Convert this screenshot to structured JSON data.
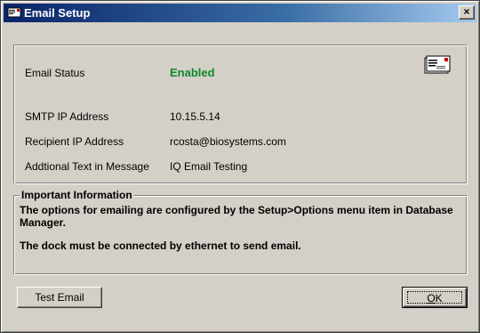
{
  "window": {
    "title": "Email Setup",
    "close_glyph": "×"
  },
  "status": {
    "email_status_label": "Email Status",
    "email_status_value": "Enabled",
    "email_status_color": "#0c8a2c",
    "smtp_label": "SMTP IP Address",
    "smtp_value": "10.15.5.14",
    "recipient_label": "Recipient IP Address",
    "recipient_value": "rcosta@biosystems.com",
    "additional_label": "Addtional Text in Message",
    "additional_value": "IQ Email Testing",
    "icon": "email-envelope-icon"
  },
  "info": {
    "heading": "Important Information",
    "line1": "The options for emailing are configured by the Setup>Options menu item in Database Manager.",
    "line2": "The dock must be connected by ethernet to send email."
  },
  "buttons": {
    "test_email": "Test Email",
    "ok_first": "O",
    "ok_rest": "K"
  }
}
